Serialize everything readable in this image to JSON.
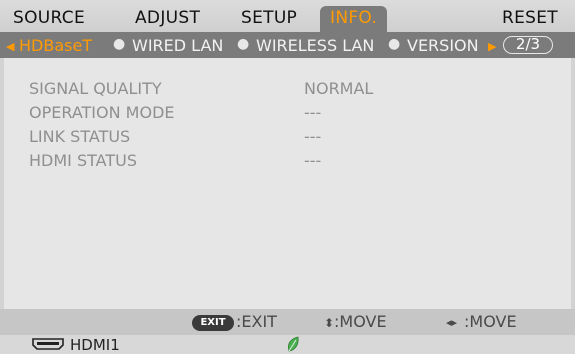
{
  "menu_tabs": [
    {
      "label": "SOURCE",
      "active": false
    },
    {
      "label": "ADJUST",
      "active": false
    },
    {
      "label": "SETUP",
      "active": false
    },
    {
      "label": "INFO.",
      "active": true
    },
    {
      "label": "RESET",
      "active": false
    }
  ],
  "sub_tabs": [
    {
      "label": "HDBaseT",
      "active": true
    },
    {
      "label": "WIRED LAN",
      "active": false
    },
    {
      "label": "WIRELESS LAN",
      "active": false
    },
    {
      "label": "VERSION",
      "active": false
    }
  ],
  "page_indicator": "2/3",
  "info_rows": [
    {
      "label": "SIGNAL QUALITY",
      "value": "NORMAL"
    },
    {
      "label": "OPERATION MODE",
      "value": "---"
    },
    {
      "label": "LINK STATUS",
      "value": "---"
    },
    {
      "label": "HDMI STATUS",
      "value": "---"
    }
  ],
  "footer": {
    "exit_badge": "EXIT",
    "exit_label": ":EXIT",
    "move_vertical": ":MOVE",
    "move_horizontal": ":MOVE"
  },
  "status": {
    "input_source": "HDMI1",
    "input_icon": "hdmi-connector-icon",
    "eco_icon": "eco-leaf-icon"
  },
  "colors": {
    "accent": "#ff9a00",
    "tab_active_bg": "#7b7b7b",
    "panel_bg": "#e6e6e6",
    "eco_green": "#4caf50"
  }
}
